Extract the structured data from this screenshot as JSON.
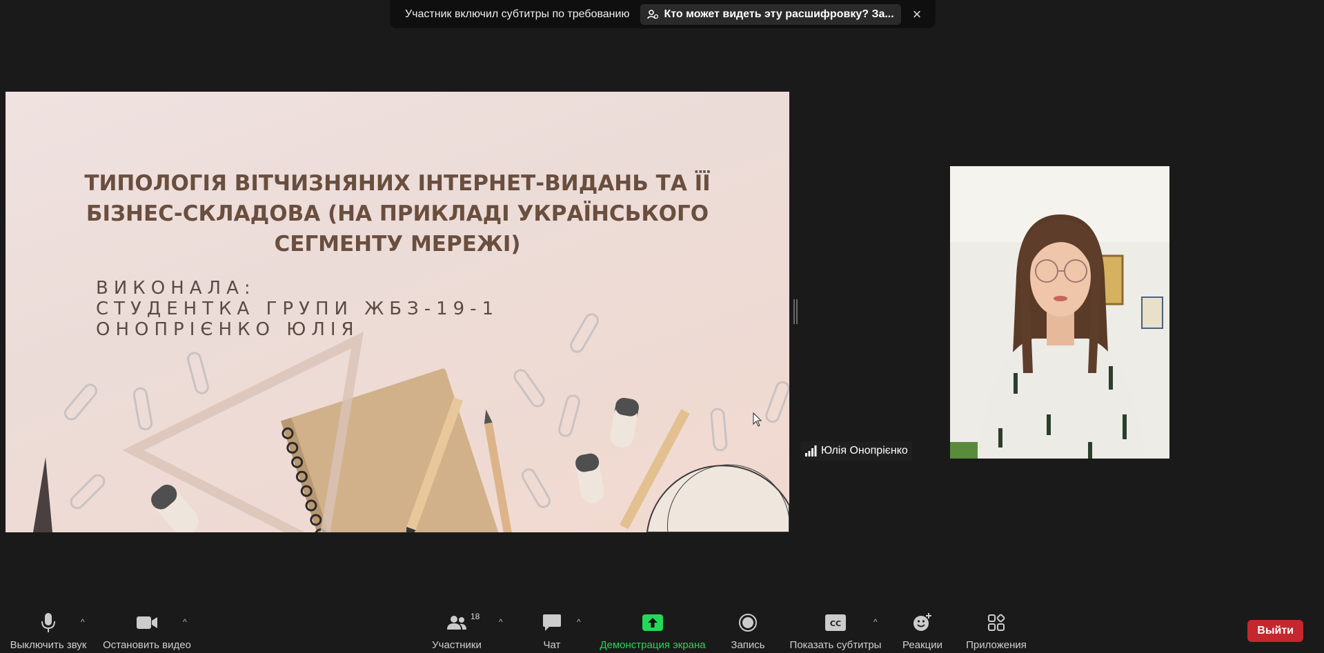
{
  "notification": {
    "text": "Участник включил субтитры по требованию",
    "link_label": "Кто может видеть эту расшифровку? За...",
    "close_label": "×"
  },
  "slide": {
    "title": "ТИПОЛОГІЯ ВІТЧИЗНЯНИХ ІНТЕРНЕТ-ВИДАНЬ ТА ЇЇ БІЗНЕС-СКЛАДОВА (НА ПРИКЛАДІ УКРАЇНСЬКОГО СЕГМЕНТУ МЕРЕЖІ)",
    "author_lines": [
      "ВИКОНАЛА:",
      "СТУДЕНТКА ГРУПИ ЖБЗ-19-1",
      "ОНОПРІЄНКО ЮЛІЯ"
    ]
  },
  "participant": {
    "name": "Юлія Онопрієнко"
  },
  "toolbar": {
    "mute": "Выключить звук",
    "video": "Остановить видео",
    "participants": "Участники",
    "participants_count": "18",
    "chat": "Чат",
    "share": "Демонстрация экрана",
    "record": "Запись",
    "captions": "Показать субтитры",
    "reactions": "Реакции",
    "apps": "Приложения",
    "leave": "Выйти",
    "caret": "^"
  },
  "colors": {
    "accent_green": "#23d959",
    "leave_red": "#c6262e"
  }
}
